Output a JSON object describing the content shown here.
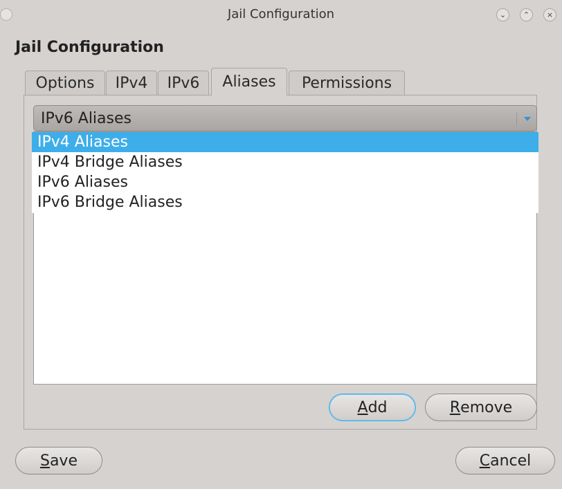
{
  "window": {
    "title": "Jail Configuration",
    "controls": [
      "minimize-icon",
      "maximize-icon",
      "close-icon"
    ]
  },
  "heading": "Jail Configuration",
  "tabs": [
    {
      "label": "Options",
      "active": false
    },
    {
      "label": "IPv4",
      "active": false
    },
    {
      "label": "IPv6",
      "active": false
    },
    {
      "label": "Aliases",
      "active": true
    },
    {
      "label": "Permissions",
      "active": false
    }
  ],
  "combo": {
    "value": "IPv6 Aliases",
    "options": [
      {
        "label": "IPv4 Aliases",
        "highlighted": true
      },
      {
        "label": "IPv4 Bridge Aliases",
        "highlighted": false
      },
      {
        "label": "IPv6 Aliases",
        "highlighted": false
      },
      {
        "label": "IPv6 Bridge Aliases",
        "highlighted": false
      }
    ]
  },
  "buttons": {
    "add": {
      "mnemonic": "A",
      "rest": "dd"
    },
    "remove": {
      "mnemonic": "R",
      "rest": "emove"
    },
    "save": {
      "mnemonic": "S",
      "rest": "ave"
    },
    "cancel": {
      "mnemonic": "C",
      "rest": "ancel"
    }
  },
  "colors": {
    "accent": "#3daee9",
    "window_bg": "#d6d2d0"
  }
}
